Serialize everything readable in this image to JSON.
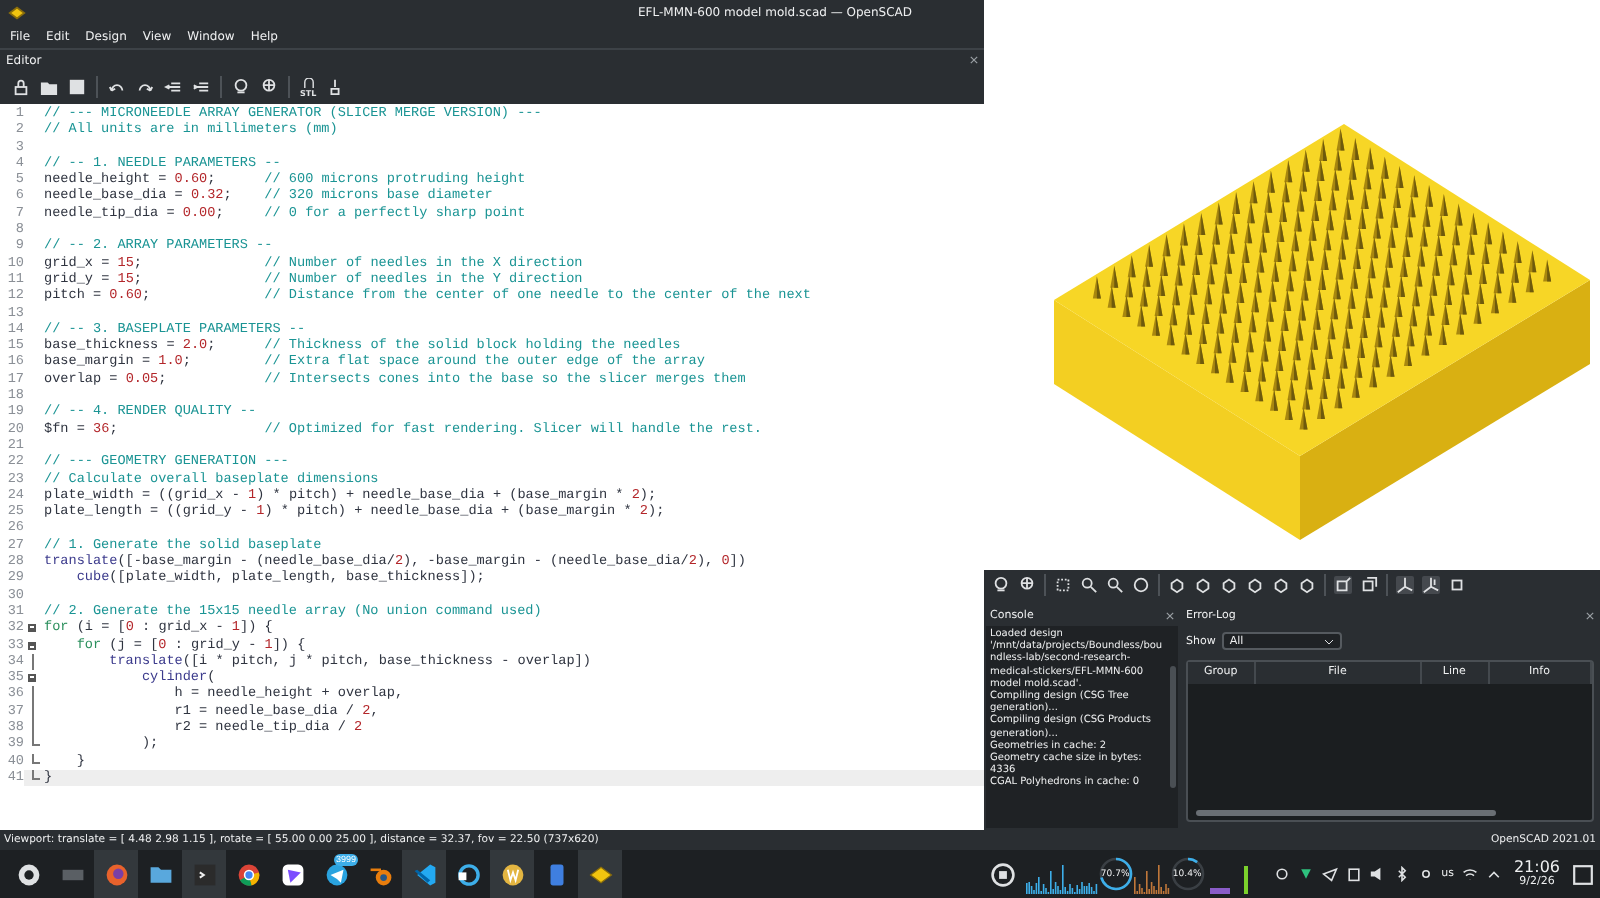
{
  "window": {
    "title": "EFL-MMN-600 model mold.scad — OpenSCAD"
  },
  "menu": [
    "File",
    "Edit",
    "Design",
    "View",
    "Window",
    "Help"
  ],
  "editor": {
    "title": "Editor",
    "export_label": "STL",
    "lines": [
      {
        "number": "1",
        "text": "// --- MICRONEEDLE ARRAY GENERATOR (SLICER MERGE VERSION) ---",
        "current": false
      },
      {
        "number": "2",
        "text": "// All units are in millimeters (mm)",
        "current": false
      },
      {
        "number": "3",
        "current": false
      },
      {
        "number": "4",
        "text": "// -- 1. NEEDLE PARAMETERS --",
        "current": false
      },
      {
        "number": "5",
        "text": "needle_height = 0.60;      // 600 microns protruding height",
        "current": false
      },
      {
        "number": "6",
        "text": "needle_base_dia = 0.32;    // 320 microns base diameter",
        "current": false
      },
      {
        "number": "7",
        "text": "needle_tip_dia = 0.00;     // 0 for a perfectly sharp point",
        "current": false
      },
      {
        "number": "8",
        "current": false
      },
      {
        "number": "9",
        "text": "// -- 2. ARRAY PARAMETERS --",
        "current": false
      },
      {
        "number": "10",
        "text": "grid_x = 15;               // Number of needles in the X direction",
        "current": false
      },
      {
        "number": "11",
        "text": "grid_y = 15;               // Number of needles in the Y direction",
        "current": false
      },
      {
        "number": "12",
        "text": "pitch = 0.60;              // Distance from the center of one needle to the center of the next",
        "current": false
      },
      {
        "number": "13",
        "current": false
      },
      {
        "number": "14",
        "text": "// -- 3. BASEPLATE PARAMETERS --",
        "current": false
      },
      {
        "number": "15",
        "text": "base_thickness = 2.0;      // Thickness of the solid block holding the needles",
        "current": false
      },
      {
        "number": "16",
        "text": "base_margin = 1.0;         // Extra flat space around the outer edge of the array",
        "current": false
      },
      {
        "number": "17",
        "text": "overlap = 0.05;            // Intersects cones into the base so the slicer merges them",
        "current": false
      },
      {
        "number": "18",
        "current": false
      },
      {
        "number": "19",
        "text": "// -- 4. RENDER QUALITY --",
        "current": false
      },
      {
        "number": "20",
        "text": "$fn = 36;                  // Optimized for fast rendering. Slicer will handle the rest.",
        "current": false
      },
      {
        "number": "21",
        "current": false
      },
      {
        "number": "22",
        "text": "// --- GEOMETRY GENERATION ---",
        "current": false
      },
      {
        "number": "23",
        "text": "// Calculate overall baseplate dimensions",
        "current": false
      },
      {
        "number": "24",
        "text": "plate_width = ((grid_x - 1) * pitch) + needle_base_dia + (base_margin * 2);",
        "current": false
      },
      {
        "number": "25",
        "text": "plate_length = ((grid_y - 1) * pitch) + needle_base_dia + (base_margin * 2);",
        "current": false
      },
      {
        "number": "26",
        "current": false
      },
      {
        "number": "27",
        "text": "// 1. Generate the solid baseplate",
        "current": false
      },
      {
        "number": "28",
        "text": "translate([-base_margin - (needle_base_dia/2), -base_margin - (needle_base_dia/2), 0])",
        "current": false
      },
      {
        "number": "29",
        "text": "    cube([plate_width, plate_length, base_thickness]);",
        "current": false
      },
      {
        "number": "30",
        "current": false
      },
      {
        "number": "31",
        "text": "// 2. Generate the 15x15 needle array (No union command used)",
        "current": false
      },
      {
        "number": "32",
        "text": "for (i = [0 : grid_x - 1]) {",
        "current": false,
        "kind": "fold_start"
      },
      {
        "number": "33",
        "text": "    for (j = [0 : grid_y - 1]) {",
        "current": false,
        "kind": "fold_start"
      },
      {
        "number": "34",
        "text": "        translate([i * pitch, j * pitch, base_thickness - overlap])",
        "current": false,
        "kind": "fold_inner"
      },
      {
        "number": "35",
        "text": "            cylinder(",
        "current": false,
        "kind": "fold_start"
      },
      {
        "number": "36",
        "text": "                h = needle_height + overlap,",
        "current": false,
        "kind": "fold_inner"
      },
      {
        "number": "37",
        "text": "                r1 = needle_base_dia / 2,",
        "current": false,
        "kind": "fold_inner"
      },
      {
        "number": "38",
        "text": "                r2 = needle_tip_dia / 2",
        "current": false,
        "kind": "fold_inner"
      },
      {
        "number": "39",
        "text": "            );",
        "current": false,
        "kind": "fold_end"
      },
      {
        "number": "40",
        "text": "    }",
        "current": false,
        "kind": "fold_end"
      },
      {
        "number": "41",
        "text": "}",
        "current": true,
        "kind": "fold_end"
      }
    ]
  },
  "console": {
    "title": "Console",
    "messages": [
      "Loaded design '/mnt/data/projects/Boundless/boundless-lab/second-research-medical-stickers/EFL-MMN-600 model mold.scad'.",
      "Compiling design (CSG Tree generation)...",
      "Compiling design (CSG Products generation)...",
      "Geometries in cache: 2",
      "Geometry cache size in bytes: 4336",
      "CGAL Polyhedrons in cache: 0"
    ]
  },
  "error_log": {
    "title": "Error-Log",
    "show_label": "Show",
    "filter": "All",
    "columns": [
      "Group",
      "File",
      "Line",
      "Info"
    ]
  },
  "status_bar": {
    "viewport": "Viewport: translate = [ 4.48 2.98 1.15 ], rotate = [ 55.00 0.00 25.00 ], distance = 32.37, fov = 22.50 (737x620)",
    "version": "OpenSCAD 2021.01"
  },
  "taskbar": {
    "badge": "3999",
    "cpu_1": "70.7%",
    "cpu_2": "10.4%",
    "keyboard_layout": "us",
    "time": "21:06",
    "date": "9/2/26"
  }
}
